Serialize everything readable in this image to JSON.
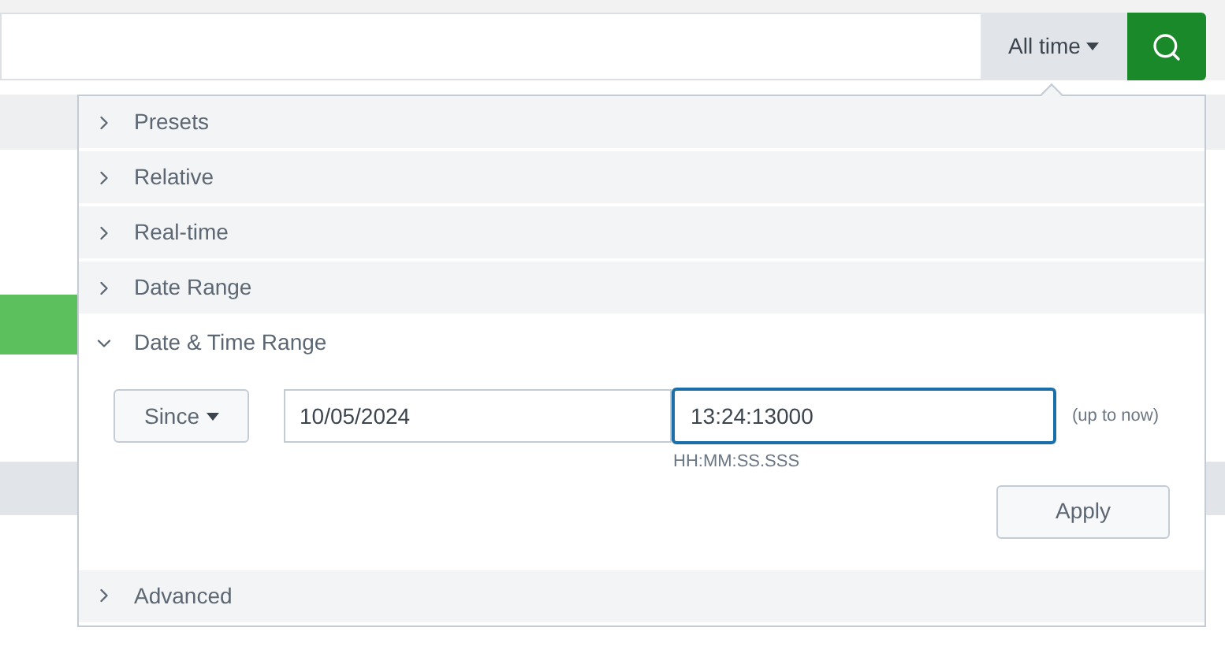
{
  "search_bar": {
    "time_picker": {
      "label": "All time",
      "open": true
    }
  },
  "time_range_menu": {
    "sections": [
      {
        "label": "Presets",
        "expanded": false
      },
      {
        "label": "Relative",
        "expanded": false
      },
      {
        "label": "Real-time",
        "expanded": false
      },
      {
        "label": "Date Range",
        "expanded": false
      },
      {
        "label": "Date & Time Range",
        "expanded": true,
        "kind": "datetime",
        "mode": "Since",
        "date": "10/05/2024",
        "time": "13:24:13000",
        "time_focused": true,
        "time_hint": "HH:MM:SS.SSS",
        "note": "(up to now)",
        "apply": "Apply"
      },
      {
        "label": "Advanced",
        "expanded": false
      }
    ]
  }
}
